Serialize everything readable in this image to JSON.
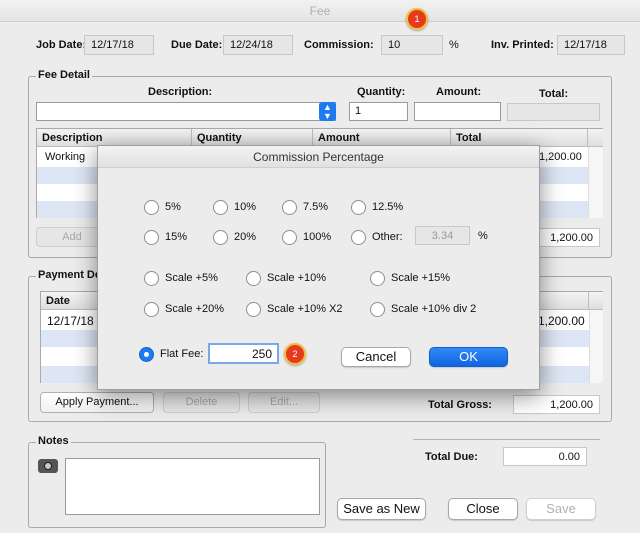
{
  "window": {
    "title": "Fee"
  },
  "header": {
    "job_date_label": "Job Date:",
    "job_date": "12/17/18",
    "due_date_label": "Due Date:",
    "due_date": "12/24/18",
    "commission_label": "Commission:",
    "commission": "10",
    "percent": "%",
    "inv_printed_label": "Inv. Printed:",
    "inv_printed": "12/17/18"
  },
  "fee_detail": {
    "group_label": "Fee Detail",
    "description_label": "Description:",
    "quantity_label": "Quantity:",
    "amount_label": "Amount:",
    "total_label": "Total:",
    "quantity_value": "1",
    "columns": [
      "Description",
      "Quantity",
      "Amount",
      "Total"
    ],
    "rows": [
      {
        "description": "Working",
        "total": "1,200.00"
      }
    ],
    "add_label": "Add",
    "total_value": "1,200.00"
  },
  "payment": {
    "group_label": "Payment De",
    "columns": [
      "Date"
    ],
    "rows": [
      {
        "date": "12/17/18",
        "amount": "1,200.00"
      }
    ],
    "apply_label": "Apply Payment...",
    "delete_label": "Delete",
    "edit_label": "Edit...",
    "total_gross_label": "Total Gross:",
    "total_gross": "1,200.00"
  },
  "notes": {
    "group_label": "Notes",
    "total_due_label": "Total Due:",
    "total_due": "0.00"
  },
  "footer": {
    "save_as_new": "Save as New",
    "close": "Close",
    "save": "Save"
  },
  "dialog": {
    "title": "Commission Percentage",
    "options_row1": [
      "5%",
      "10%",
      "7.5%",
      "12.5%"
    ],
    "options_row2": [
      "15%",
      "20%",
      "100%",
      "Other:"
    ],
    "other_value": "3.34",
    "other_unit": "%",
    "scale_row1": [
      "Scale +5%",
      "Scale +10%",
      "Scale +15%"
    ],
    "scale_row2": [
      "Scale +20%",
      "Scale +10% X2",
      "Scale +10% div 2"
    ],
    "flat_fee_label": "Flat Fee:",
    "flat_fee_value": "250",
    "cancel": "Cancel",
    "ok": "OK"
  },
  "badges": [
    "1",
    "2"
  ],
  "colors": {
    "accent": "#1c7bf0",
    "badge": "#e53a1c"
  }
}
